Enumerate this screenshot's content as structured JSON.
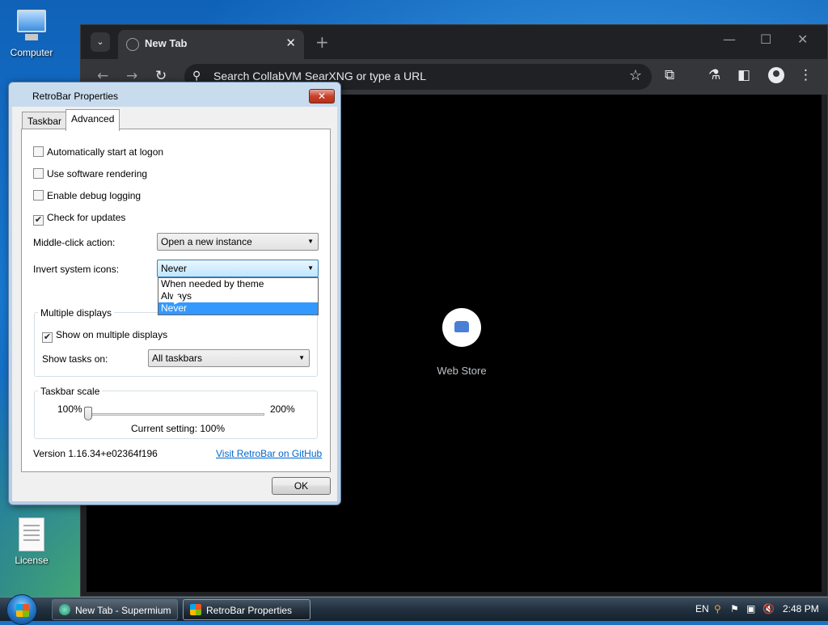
{
  "desktop": {
    "icons": [
      {
        "label": "Computer"
      },
      {
        "label": "License"
      }
    ]
  },
  "browser": {
    "tab_title": "New Tab",
    "address_placeholder": "Search CollabVM SearXNG or type a URL",
    "shortcut_label": "Web Store"
  },
  "dialog": {
    "title": "RetroBar Properties",
    "close_glyph": "✕",
    "tabs": [
      {
        "label": "Taskbar",
        "selected": false
      },
      {
        "label": "Advanced",
        "selected": true
      }
    ],
    "checkboxes": [
      {
        "label": "Automatically start at logon",
        "checked": false
      },
      {
        "label": "Use software rendering",
        "checked": false
      },
      {
        "label": "Enable debug logging",
        "checked": false
      },
      {
        "label": "Check for updates",
        "checked": true
      }
    ],
    "middle_click": {
      "label": "Middle-click action:",
      "value": "Open a new instance"
    },
    "invert_icons": {
      "label": "Invert system icons:",
      "value": "Never",
      "options": [
        "When needed by theme",
        "Always",
        "Never"
      ],
      "selected_index": 2
    },
    "multiple_displays": {
      "title": "Multiple displays",
      "show_on_multiple": {
        "label": "Show on multiple displays",
        "checked": true
      },
      "show_tasks_label": "Show tasks on:",
      "show_tasks_value": "All taskbars"
    },
    "taskbar_scale": {
      "title": "Taskbar scale",
      "min_label": "100%",
      "max_label": "200%",
      "current": "Current setting: 100%",
      "value_fraction": 0
    },
    "version": "Version 1.16.34+e02364f196",
    "github_link": "Visit RetroBar on GitHub",
    "ok_label": "OK"
  },
  "taskbar": {
    "buttons": [
      {
        "label": "New Tab - Supermium",
        "active": false
      },
      {
        "label": "RetroBar Properties",
        "active": true
      }
    ],
    "tray": {
      "lang": "EN",
      "time": "2:48 PM"
    }
  },
  "colors": {
    "accent_selection": "#3399ff",
    "link": "#0066cc",
    "browser_bg": "#202124"
  }
}
